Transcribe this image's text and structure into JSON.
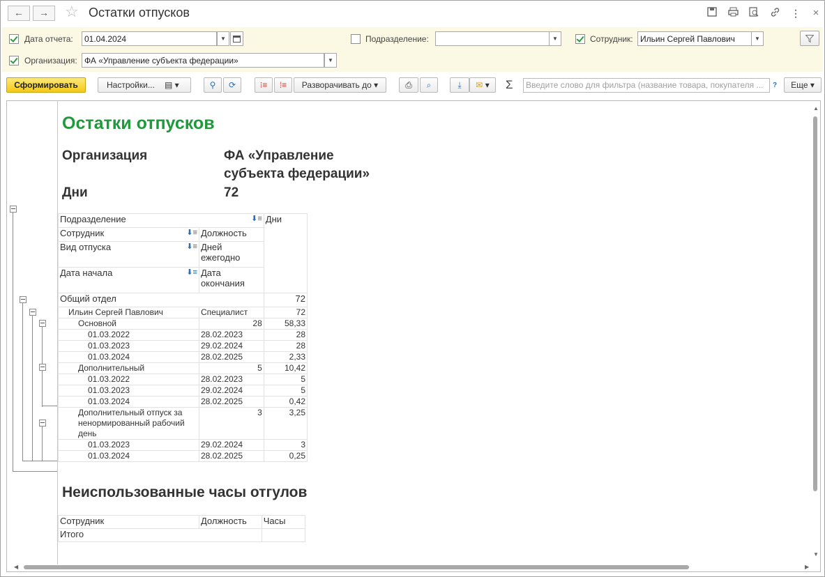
{
  "window": {
    "title": "Остатки отпусков",
    "back_icon": "←",
    "forward_icon": "→"
  },
  "filters": {
    "date_label": "Дата отчета:",
    "date_value": "01.04.2024",
    "date_checked": true,
    "department_label": "Подразделение:",
    "department_value": "",
    "department_checked": false,
    "employee_label": "Сотрудник:",
    "employee_value": "Ильин Сергей Павлович",
    "employee_checked": true,
    "org_label": "Организация:",
    "org_value": "ФА «Управление субъекта федерации»",
    "org_checked": true
  },
  "toolbar": {
    "generate": "Сформировать",
    "settings": "Настройки...",
    "expand_to": "Разворачивать до",
    "search_placeholder": "Введите слово для фильтра (название товара, покупателя ...",
    "help": "?",
    "more": "Еще",
    "sum_icon": "Σ"
  },
  "report": {
    "title": "Остатки отпусков",
    "org_label": "Организация",
    "org_value_line1": "ФА «Управление",
    "org_value_line2": "субъекта федерации»",
    "days_label": "Дни",
    "days_value": "72",
    "table_headers": {
      "department": "Подразделение",
      "days": "Дни",
      "employee": "Сотрудник",
      "position": "Должность",
      "vacation_type": "Вид отпуска",
      "days_per_year_1": "Дней",
      "days_per_year_2": "ежегодно",
      "start_date": "Дата начала",
      "end_date_1": "Дата",
      "end_date_2": "окончания"
    },
    "department_row": {
      "name": "Общий отдел",
      "days": "72"
    },
    "employee_row": {
      "name": "Ильин Сергей Павлович",
      "position": "Специалист",
      "days": "72"
    },
    "groups": [
      {
        "name": "Основной",
        "per_year": "28",
        "days": "58,33",
        "rows": [
          {
            "start": "01.03.2022",
            "end": "28.02.2023",
            "days": "28"
          },
          {
            "start": "01.03.2023",
            "end": "29.02.2024",
            "days": "28"
          },
          {
            "start": "01.03.2024",
            "end": "28.02.2025",
            "days": "2,33"
          }
        ]
      },
      {
        "name": "Дополнительный",
        "per_year": "5",
        "days": "10,42",
        "rows": [
          {
            "start": "01.03.2022",
            "end": "28.02.2023",
            "days": "5"
          },
          {
            "start": "01.03.2023",
            "end": "29.02.2024",
            "days": "5"
          },
          {
            "start": "01.03.2024",
            "end": "28.02.2025",
            "days": "0,42"
          }
        ]
      },
      {
        "name_line1": "Дополнительный отпуск за",
        "name_line2": "ненормированный рабочий",
        "name_line3": "день",
        "per_year": "3",
        "days": "3,25",
        "rows": [
          {
            "start": "01.03.2023",
            "end": "29.02.2024",
            "days": "3"
          },
          {
            "start": "01.03.2024",
            "end": "28.02.2025",
            "days": "0,25"
          }
        ]
      }
    ],
    "section2_title": "Неиспользованные часы отгулов",
    "table2_headers": {
      "employee": "Сотрудник",
      "position": "Должность",
      "hours": "Часы"
    },
    "table2_total": "Итого"
  }
}
